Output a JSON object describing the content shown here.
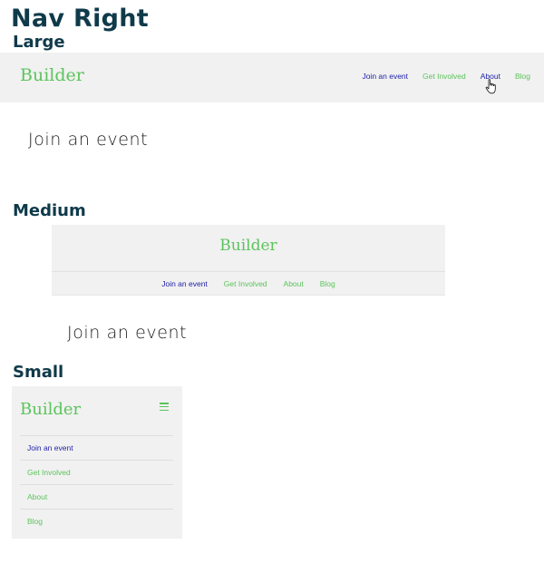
{
  "page": {
    "title": "Nav Right"
  },
  "colors": {
    "heading": "#0f3a4a",
    "brand": "#5cc45c",
    "active_link": "#1f1fa8",
    "nav_background": "#f1f1f1"
  },
  "large": {
    "heading": "Large",
    "brand": "Builder",
    "links": [
      "Join an event",
      "Get Involved",
      "About",
      "Blog"
    ],
    "content": "Join an event",
    "cursor_icon": "pointer-hand-icon"
  },
  "medium": {
    "heading": "Medium",
    "brand": "Builder",
    "links": [
      "Join an event",
      "Get Involved",
      "About",
      "Blog"
    ],
    "content": "Join an event"
  },
  "small": {
    "heading": "Small",
    "brand": "Builder",
    "menu_icon": "hamburger-icon",
    "links": [
      "Join an event",
      "Get Involved",
      "About",
      "Blog"
    ]
  }
}
